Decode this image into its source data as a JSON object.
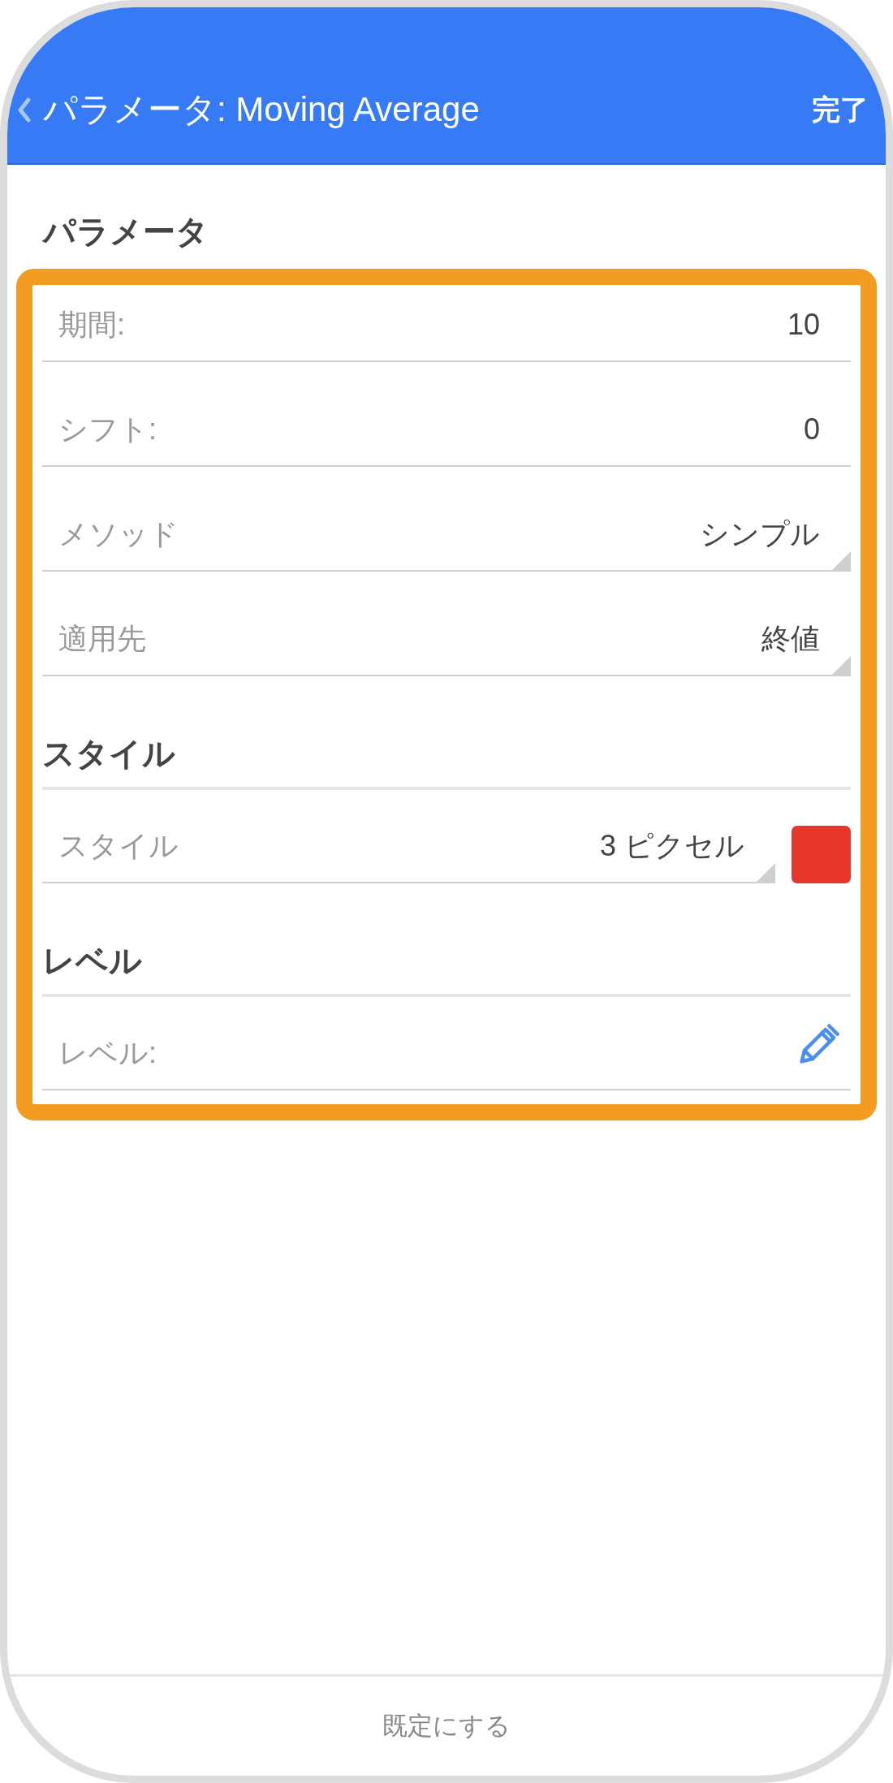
{
  "header": {
    "title": "パラメータ: Moving Average",
    "done": "完了"
  },
  "highlighted": true,
  "sections": [
    {
      "title": "パラメータ",
      "rows": [
        {
          "kind": "number",
          "label": "期間:",
          "value": "10"
        },
        {
          "kind": "number",
          "label": "シフト:",
          "value": "0"
        },
        {
          "kind": "dropdown",
          "label": "メソッド",
          "value": "シンプル"
        },
        {
          "kind": "dropdown",
          "label": "適用先",
          "value": "終値"
        }
      ]
    },
    {
      "title": "スタイル",
      "rows": [
        {
          "kind": "style",
          "label": "スタイル",
          "value": "3 ピクセル",
          "color": "#e8352a"
        }
      ]
    },
    {
      "title": "レベル",
      "rows": [
        {
          "kind": "edit",
          "label": "レベル:"
        }
      ]
    }
  ],
  "footer": {
    "button": "既定にする"
  }
}
